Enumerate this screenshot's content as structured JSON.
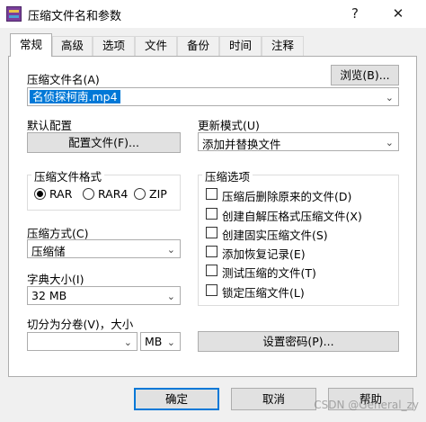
{
  "window": {
    "title": "压缩文件名和参数",
    "help_glyph": "?",
    "close_glyph": "✕"
  },
  "tabs": [
    {
      "label": "常规"
    },
    {
      "label": "高级"
    },
    {
      "label": "选项"
    },
    {
      "label": "文件"
    },
    {
      "label": "备份"
    },
    {
      "label": "时间"
    },
    {
      "label": "注释"
    }
  ],
  "archive": {
    "name_label": "压缩文件名(A)",
    "browse_label": "浏览(B)...",
    "name_value": "名侦探柯南.mp4"
  },
  "profile": {
    "label": "默认配置",
    "button": "配置文件(F)..."
  },
  "update": {
    "label": "更新模式(U)",
    "value": "添加并替换文件"
  },
  "format": {
    "legend": "压缩文件格式",
    "options": [
      "RAR",
      "RAR4",
      "ZIP"
    ],
    "selected": "RAR"
  },
  "method": {
    "label": "压缩方式(C)",
    "value": "压缩储"
  },
  "dictionary": {
    "label": "字典大小(I)",
    "value": "32 MB"
  },
  "split": {
    "label": "切分为分卷(V)，大小",
    "value": "",
    "unit": "MB"
  },
  "options": {
    "legend": "压缩选项",
    "items": [
      {
        "label": "压缩后删除原来的文件(D)",
        "checked": false
      },
      {
        "label": "创建自解压格式压缩文件(X)",
        "checked": false
      },
      {
        "label": "创建固实压缩文件(S)",
        "checked": false
      },
      {
        "label": "添加恢复记录(E)",
        "checked": false
      },
      {
        "label": "测试压缩的文件(T)",
        "checked": false
      },
      {
        "label": "锁定压缩文件(L)",
        "checked": false
      }
    ]
  },
  "password_button": "设置密码(P)...",
  "footer": {
    "ok": "确定",
    "cancel": "取消",
    "help": "帮助"
  },
  "watermark": "CSDN @General_zy"
}
